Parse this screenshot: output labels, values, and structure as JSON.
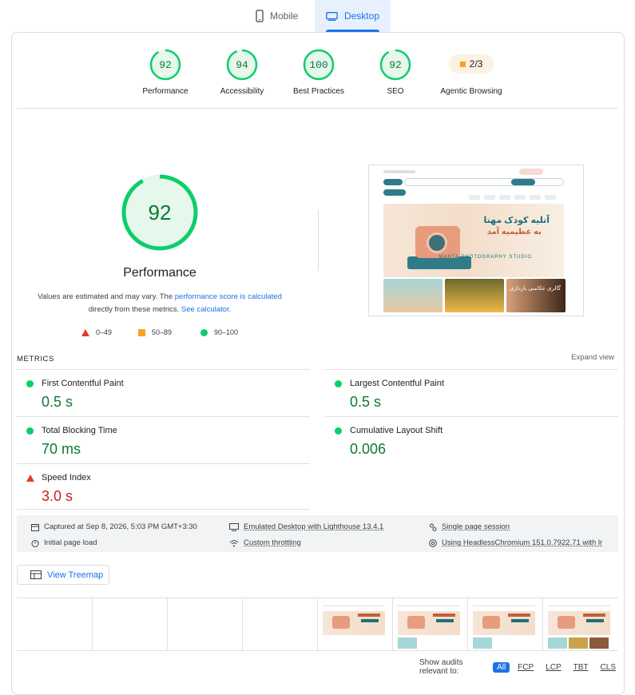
{
  "tabs": {
    "mobile": "Mobile",
    "desktop": "Desktop",
    "active": "desktop"
  },
  "categories": [
    {
      "score": "92",
      "label": "Performance",
      "value": 92
    },
    {
      "score": "94",
      "label": "Accessibility",
      "value": 94
    },
    {
      "score": "100",
      "label": "Best Practices",
      "value": 100
    },
    {
      "score": "92",
      "label": "SEO",
      "value": 92
    }
  ],
  "agentic": {
    "score": "2/3",
    "label": "Agentic Browsing"
  },
  "performance": {
    "score": "92",
    "value": 92,
    "title": "Performance",
    "desc_prefix": "Values are estimated and may vary. The",
    "desc_link1": "performance score is calculated",
    "desc_mid": "directly from these metrics.",
    "desc_link2": "See calculator."
  },
  "legend": {
    "fail": "0–49",
    "average": "50–89",
    "pass": "90–100"
  },
  "screenshot": {
    "banner_line1": "آتلیه کودک مهتا",
    "banner_line2": "به عظیمیه آمد",
    "banner_brand": "MAHTA PHOTOGRAPHY STUDIO",
    "gallery_label": "گالری عکاسی بارداری"
  },
  "metrics": {
    "header": "METRICS",
    "expand": "Expand view",
    "fcp": {
      "name": "First Contentful Paint",
      "value": "0.5 s"
    },
    "lcp": {
      "name": "Largest Contentful Paint",
      "value": "0.5 s"
    },
    "tbt": {
      "name": "Total Blocking Time",
      "value": "70 ms"
    },
    "cls": {
      "name": "Cumulative Layout Shift",
      "value": "0.006"
    },
    "si": {
      "name": "Speed Index",
      "value": "3.0 s"
    }
  },
  "runtime": {
    "captured": "Captured at Sep 8, 2026, 5:03 PM GMT+3:30",
    "load": "Initial page load",
    "emulation": "Emulated Desktop with Lighthouse 13.4.1",
    "throttling": "Custom throttling",
    "session": "Single page session",
    "browser": "Using HeadlessChromium 151.0.7922.71 with lr"
  },
  "treemap": {
    "label": "View Treemap"
  },
  "audit_filter": {
    "label": "Show audits relevant to:",
    "options": [
      "All",
      "FCP",
      "LCP",
      "TBT",
      "CLS"
    ],
    "active": "All"
  },
  "colors": {
    "pass": "#0cce6b",
    "pass_text": "#0b7a34",
    "average": "#f6a324",
    "fail": "#e33b2e",
    "link": "#1a73e8"
  },
  "icons": [
    "mobile-icon",
    "desktop-icon",
    "calendar-icon",
    "timer-icon",
    "monitor-icon",
    "wifi-icon",
    "session-icon",
    "chrome-icon",
    "treemap-icon"
  ]
}
